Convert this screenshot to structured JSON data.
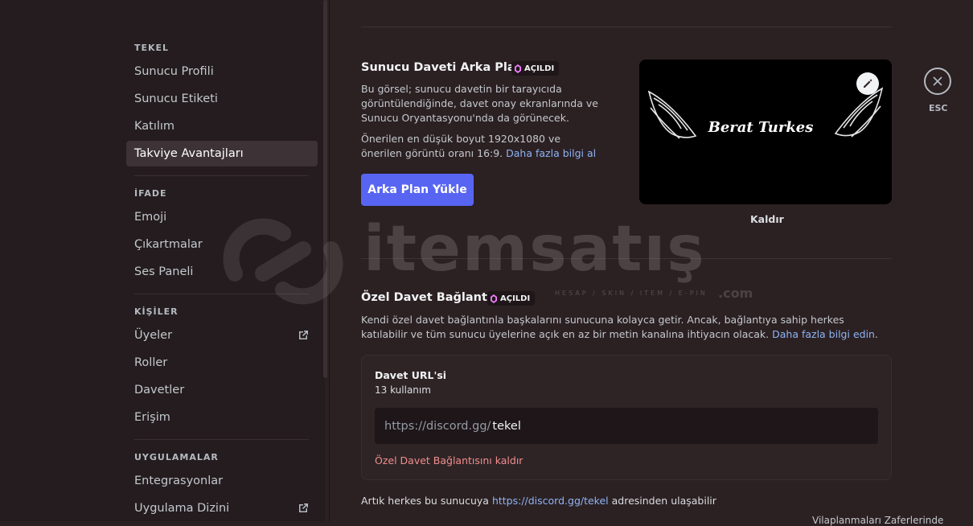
{
  "sidebar": {
    "section_server": "TEKEL",
    "server_items": [
      "Sunucu Profili",
      "Sunucu Etiketi",
      "Katılım",
      "Takviye Avantajları"
    ],
    "section_expression": "İFADE",
    "expression_items": [
      "Emoji",
      "Çıkartmalar",
      "Ses Paneli"
    ],
    "section_people": "KİŞİLER",
    "people_items": [
      "Üyeler",
      "Roller",
      "Davetler",
      "Erişim"
    ],
    "section_apps": "UYGULAMALAR",
    "apps_items": [
      "Entegrasyonlar",
      "Uygulama Dizini"
    ]
  },
  "invite_background": {
    "title": "Sunucu Daveti Arka Planı",
    "badge": "AÇILDI",
    "desc1": "Bu görsel; sunucu davetin bir tarayıcıda görüntülendiğinde, davet onay ekranlarında ve Sunucu Oryantasyonu'nda da görünecek.",
    "desc2": "Önerilen en düşük boyut 1920x1080 ve önerilen görüntü oranı 16:9.",
    "learn_more": "Daha fazla bilgi al",
    "upload_button": "Arka Plan Yükle",
    "preview_text": "Berat Turkes",
    "remove": "Kaldır"
  },
  "esc": {
    "label": "ESC"
  },
  "vanity": {
    "title": "Özel Davet Bağlantısı",
    "badge": "AÇILDI",
    "desc": "Kendi özel davet bağlantınla başkalarını sunucuna kolayca getir. Ancak, bağlantıya sahip herkes katılabilir ve tüm sunucu üyelerine açık en az bir metin kanalına ihtiyacın olacak.",
    "learn_more": "Daha fazla bilgi edin",
    "period": ".",
    "card_title": "Davet URL'si",
    "uses": "13 kullanım",
    "url_prefix": "https://discord.gg/",
    "url_value": "tekel",
    "remove_link": "Özel Davet Bağlantısını kaldır",
    "footer_before": "Artık herkes bu sunucuya ",
    "footer_link": "https://discord.gg/tekel",
    "footer_after": " adresinden ulaşabilir",
    "cut_off": "Vilaplanmaları Zaferlerinde"
  },
  "watermark": {
    "brand": "itemsatış",
    "tagline": "HESAP / SKIN / ITEM / E-PIN",
    "tld": ".com"
  },
  "colors": {
    "accent": "#5865f2",
    "link": "#8fb4f5",
    "danger": "#f28d8d",
    "badge_gem": "#f47fff"
  }
}
